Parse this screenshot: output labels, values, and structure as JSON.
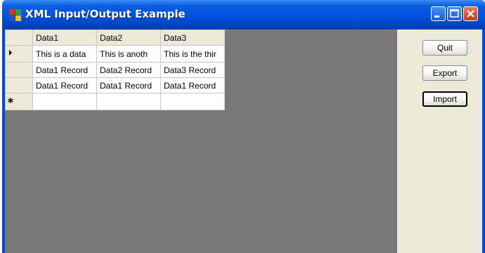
{
  "window": {
    "title": "XML Input/Output Example"
  },
  "grid": {
    "columns": [
      "Data1",
      "Data2",
      "Data3"
    ],
    "rows": [
      [
        "This is a data",
        "This is anoth",
        "This is the thir"
      ],
      [
        "Data1 Record",
        "Data2 Record",
        "Data3 Record"
      ],
      [
        "Data1 Record",
        "Data1 Record",
        "Data1 Record"
      ]
    ]
  },
  "buttons": {
    "quit": "Quit",
    "export": "Export",
    "import": "Import"
  },
  "colors": {
    "titlebar": "#0053e0",
    "grid_background": "#7a7877",
    "window_background": "#ece9d8"
  }
}
